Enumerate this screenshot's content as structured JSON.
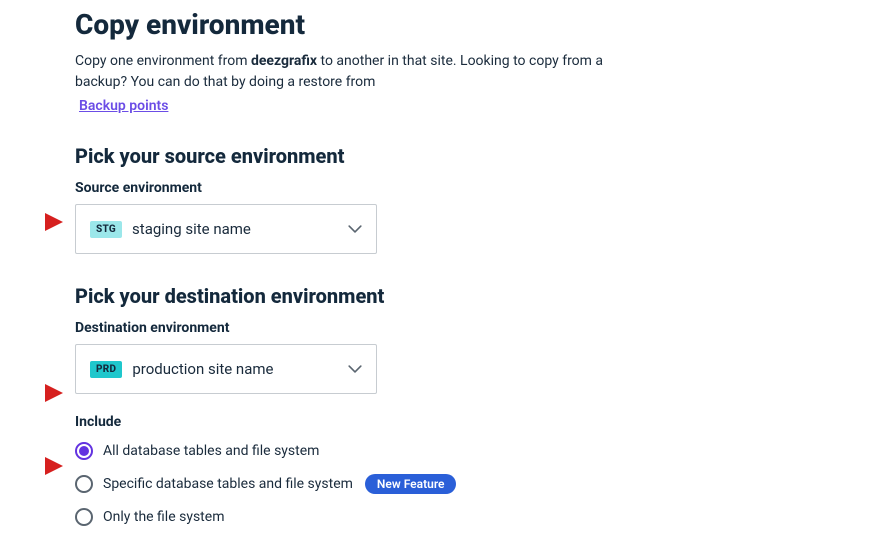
{
  "title": "Copy environment",
  "intro_before": "Copy one environment from ",
  "intro_site": "deezgrafix",
  "intro_after": " to another in that site. Looking to copy from a backup? You can do that by doing a restore from",
  "backup_link": "Backup points",
  "source": {
    "heading": "Pick your source environment",
    "label": "Source environment",
    "badge": "STG",
    "value": "staging site name"
  },
  "destination": {
    "heading": "Pick your destination environment",
    "label": "Destination environment",
    "badge": "PRD",
    "value": "production site name"
  },
  "include": {
    "label": "Include",
    "options": [
      "All database tables and file system",
      "Specific database tables and file system",
      "Only the file system"
    ],
    "new_feature": "New Feature"
  }
}
